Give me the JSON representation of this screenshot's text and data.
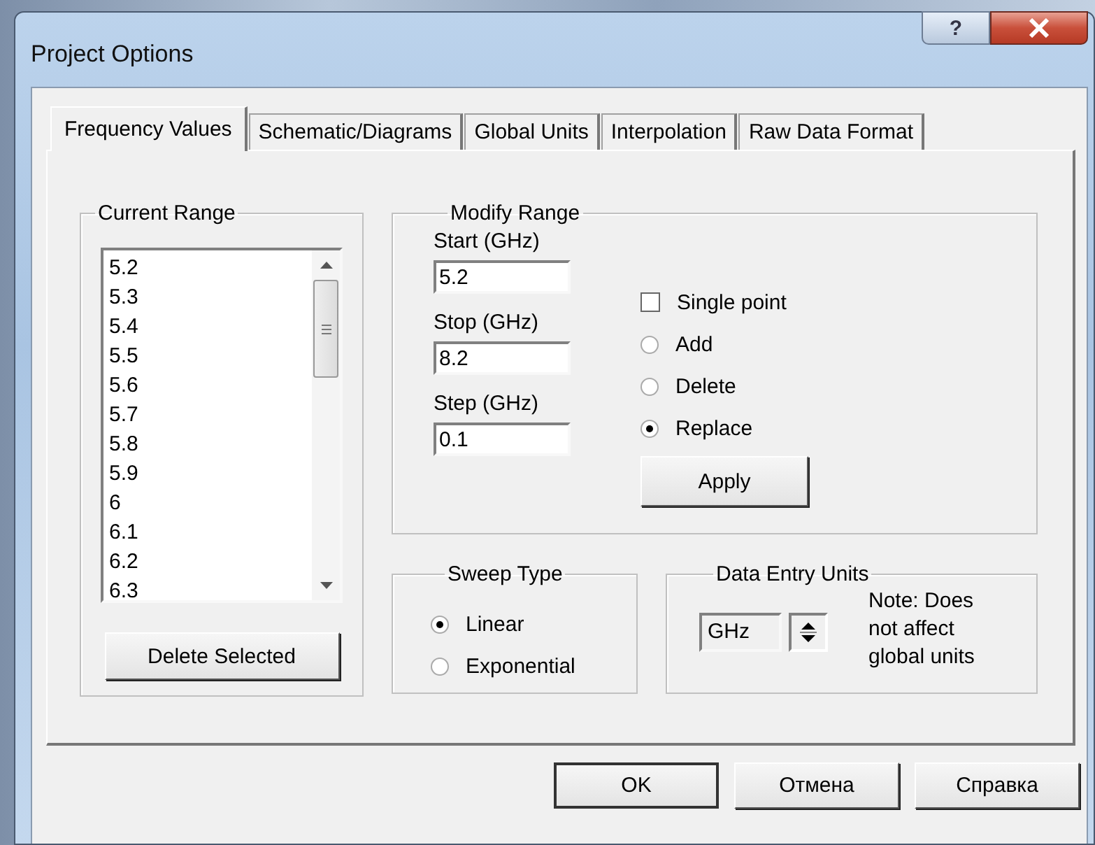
{
  "window": {
    "title": "Project Options",
    "help": "?"
  },
  "tabs": [
    {
      "label": "Frequency Values",
      "selected": true
    },
    {
      "label": "Schematic/Diagrams",
      "selected": false
    },
    {
      "label": "Global Units",
      "selected": false
    },
    {
      "label": "Interpolation",
      "selected": false
    },
    {
      "label": "Raw Data Format",
      "selected": false
    }
  ],
  "current_range": {
    "legend": "Current Range",
    "items": [
      "5.2",
      "5.3",
      "5.4",
      "5.5",
      "5.6",
      "5.7",
      "5.8",
      "5.9",
      "6",
      "6.1",
      "6.2",
      "6.3"
    ],
    "button": "Delete Selected"
  },
  "modify_range": {
    "legend": "Modify Range",
    "fields": [
      {
        "label": "Start (GHz)",
        "value": "5.2"
      },
      {
        "label": "Stop (GHz)",
        "value": "8.2"
      },
      {
        "label": "Step (GHz)",
        "value": "0.1"
      }
    ],
    "single_point": {
      "label": "Single point",
      "checked": false
    },
    "modes": [
      {
        "label": "Add",
        "selected": false
      },
      {
        "label": "Delete",
        "selected": false
      },
      {
        "label": "Replace",
        "selected": true
      }
    ],
    "button": "Apply"
  },
  "sweep_type": {
    "legend": "Sweep Type",
    "options": [
      {
        "label": "Linear",
        "selected": true
      },
      {
        "label": "Exponential",
        "selected": false
      }
    ]
  },
  "data_entry_units": {
    "legend": "Data Entry Units",
    "unit": "GHz",
    "note": "Note: Does not affect global units"
  },
  "buttons": [
    {
      "label": "OK",
      "default": true
    },
    {
      "label": "Отмена",
      "default": false
    },
    {
      "label": "Справка",
      "default": false
    }
  ]
}
